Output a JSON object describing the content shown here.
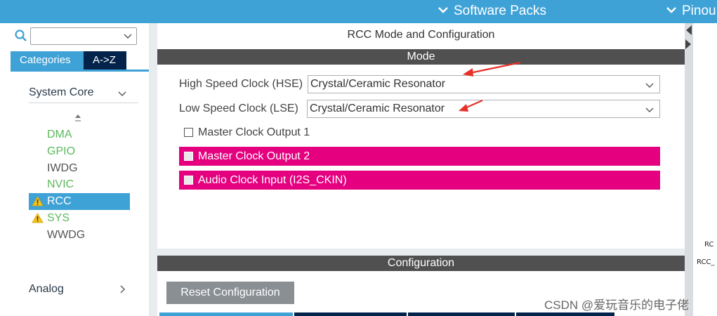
{
  "topbar": {
    "software_packs": "Software Packs",
    "pinout": "Pinou"
  },
  "left": {
    "search_value": "",
    "categories_tab": "Categories",
    "az_tab": "A->Z",
    "system_core": "System Core",
    "peripherals": [
      {
        "label": "DMA",
        "state": "green",
        "warning": false,
        "selected": false
      },
      {
        "label": "GPIO",
        "state": "green",
        "warning": false,
        "selected": false
      },
      {
        "label": "IWDG",
        "state": "gray",
        "warning": false,
        "selected": false
      },
      {
        "label": "NVIC",
        "state": "green",
        "warning": false,
        "selected": false
      },
      {
        "label": "RCC",
        "state": "selected",
        "warning": true,
        "selected": true
      },
      {
        "label": "SYS",
        "state": "green",
        "warning": true,
        "selected": false
      },
      {
        "label": "WWDG",
        "state": "gray",
        "warning": false,
        "selected": false
      }
    ],
    "analog": "Analog"
  },
  "center": {
    "title": "RCC Mode and Configuration",
    "mode_header": "Mode",
    "hse_label": "High Speed Clock (HSE)",
    "hse_value": "Crystal/Ceramic Resonator",
    "lse_label": "Low Speed Clock (LSE)",
    "lse_value": "Crystal/Ceramic Resonator",
    "mco1": "Master Clock Output 1",
    "mco2": "Master Clock Output 2",
    "i2s": "Audio Clock Input (I2S_CKIN)",
    "config_header": "Configuration",
    "reset_button": "Reset Configuration"
  },
  "right": {
    "pin_label_1": "RC",
    "pin_label_2": "RCC_"
  },
  "watermark": "CSDN @爱玩音乐的电子佬",
  "colors": {
    "accent": "#3fa2d6",
    "navy": "#03234b",
    "header_gray": "#505050",
    "pink": "#e4007f",
    "green": "#5cb85c",
    "arrow_red": "#e8302a"
  },
  "icons": {
    "search": "search-icon",
    "chevron_down": "chevron-down-icon",
    "chevron_right": "chevron-right-icon",
    "warning": "warning-icon",
    "sort": "sort-icon",
    "collapse": "collapse-triangle-icon",
    "annotation": "red-arrow-annotation"
  }
}
